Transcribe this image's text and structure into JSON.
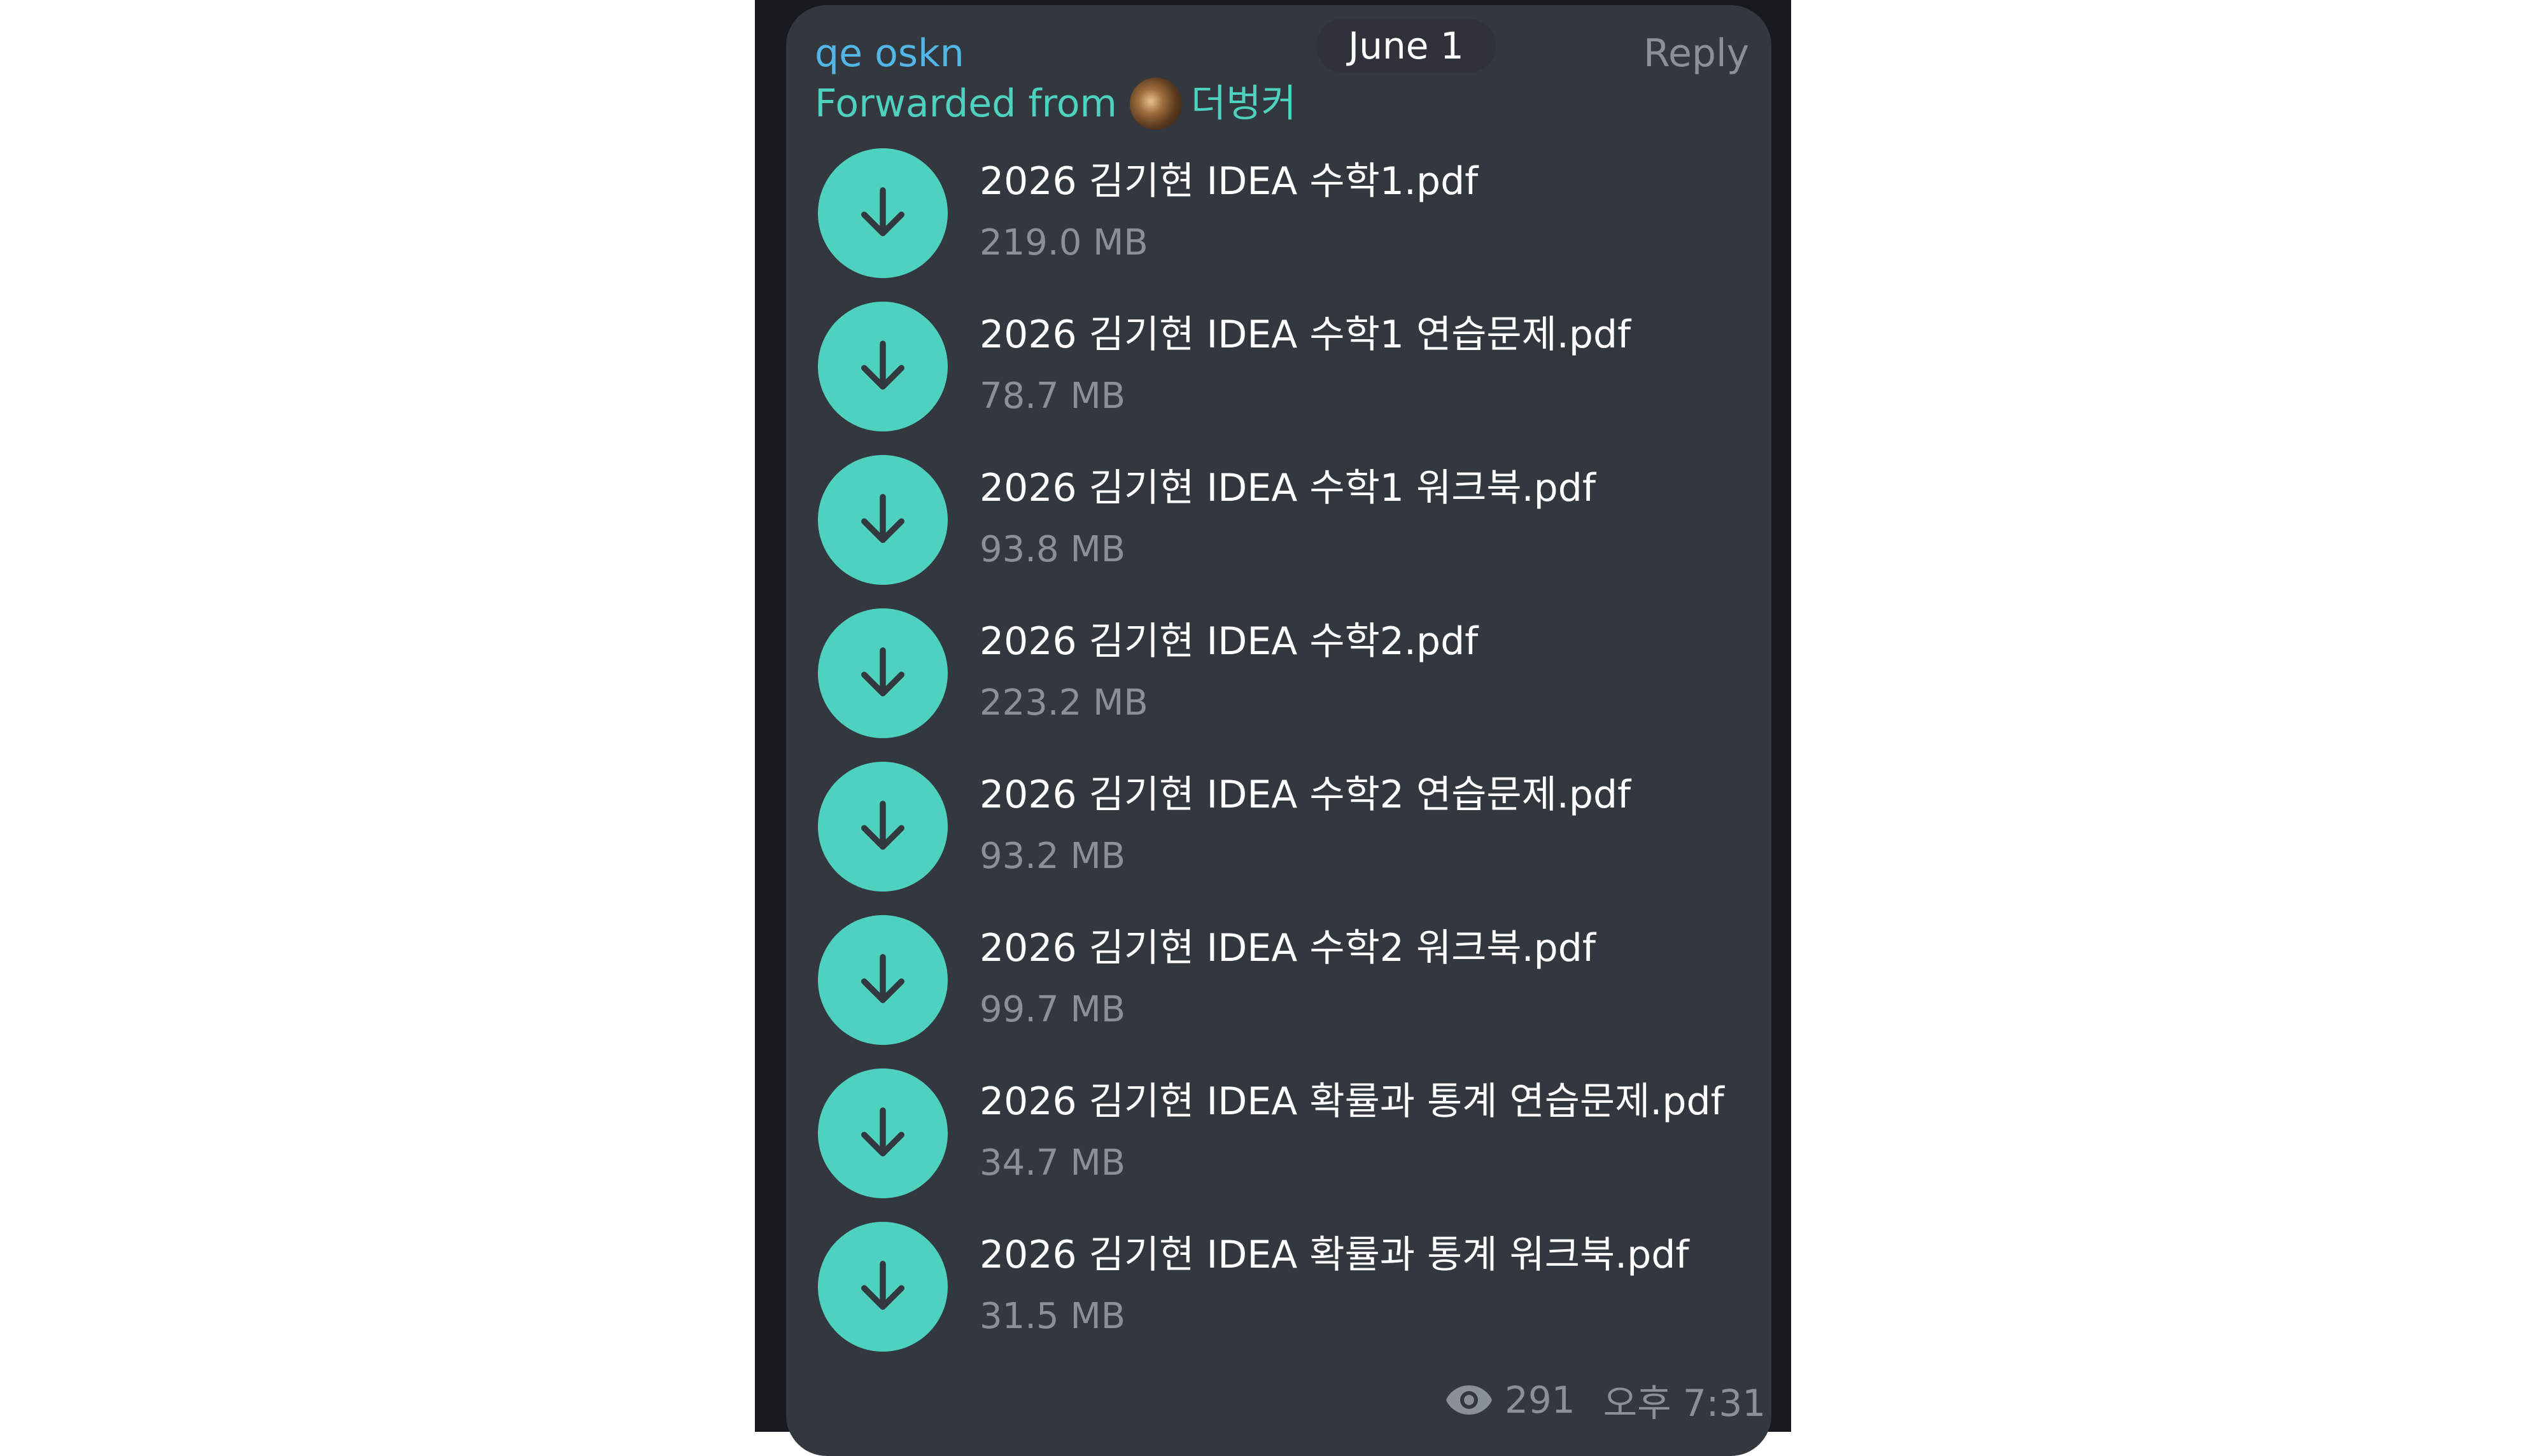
{
  "message": {
    "sender": "qe oskn",
    "forwarded_prefix": "Forwarded from",
    "forwarded_source": "더벙커",
    "date_pill": "June 1",
    "reply_label": "Reply",
    "views": "291",
    "time": "오후 7:31"
  },
  "files": [
    {
      "name": "2026 김기현 IDEA 수학1.pdf",
      "size": "219.0 MB"
    },
    {
      "name": "2026 김기현 IDEA 수학1 연습문제.pdf",
      "size": "78.7 MB"
    },
    {
      "name": "2026 김기현 IDEA 수학1 워크북.pdf",
      "size": "93.8 MB"
    },
    {
      "name": "2026 김기현 IDEA 수학2.pdf",
      "size": "223.2 MB"
    },
    {
      "name": "2026 김기현 IDEA 수학2 연습문제.pdf",
      "size": "93.2 MB"
    },
    {
      "name": "2026 김기현 IDEA 수학2 워크북.pdf",
      "size": "99.7 MB"
    },
    {
      "name": "2026 김기현 IDEA 확률과 통계 연습문제.pdf",
      "size": "34.7 MB"
    },
    {
      "name": "2026 김기현 IDEA 확률과 통계 워크북.pdf",
      "size": "31.5 MB"
    }
  ],
  "icons": {
    "download": "download-arrow-icon",
    "views": "eye-icon",
    "forward_avatar": "channel-avatar"
  },
  "colors": {
    "accent": "#4fd1c0",
    "sender": "#52b7e6",
    "bubble": "#33373e",
    "muted": "#8a9097",
    "background": "#16191d"
  }
}
